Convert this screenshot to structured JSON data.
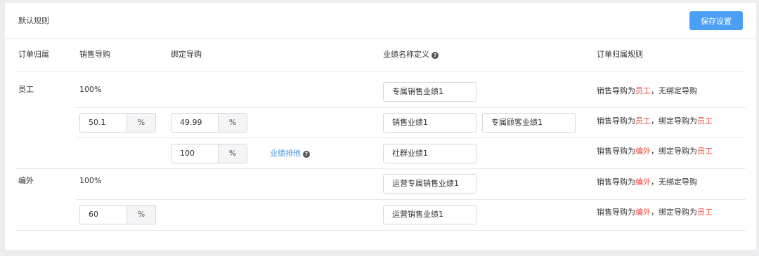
{
  "header": {
    "title": "默认规则",
    "save_label": "保存设置"
  },
  "columns": {
    "ownership": "订单归属",
    "sales_guide": "销售导购",
    "bound_guide": "绑定导购",
    "performance_name": "业绩名称定义",
    "rule": "订单归属规则"
  },
  "help_glyph": "?",
  "unit": "%",
  "groups": {
    "employee": {
      "label": "员工",
      "pct": "100%"
    },
    "external": {
      "label": "编外",
      "pct": "100%"
    }
  },
  "rows": [
    {
      "name": "专属销售业绩1",
      "rule_prefix": "销售导购为",
      "rule_hl1": "员工",
      "rule_mid": "，",
      "rule_tail": "无绑定导购"
    },
    {
      "sales_pct": "50.1",
      "bound_pct": "49.99",
      "name": "销售业绩1",
      "name2": "专属顾客业绩1",
      "rule_prefix": "销售导购为",
      "rule_hl1": "员工",
      "rule_mid": "，绑定导购为",
      "rule_hl2": "员工"
    },
    {
      "bound_pct": "100",
      "link": "业绩排他",
      "name": "社群业绩1",
      "rule_prefix": "销售导购为",
      "rule_hl1": "编外",
      "rule_mid": "，绑定导购为",
      "rule_hl2": "员工"
    },
    {
      "name": "运营专属销售业绩1",
      "rule_prefix": "销售导购为",
      "rule_hl1": "编外",
      "rule_mid": "，",
      "rule_tail": "无绑定导购"
    },
    {
      "sales_pct": "60",
      "name": "运营销售业绩1",
      "rule_prefix": "销售导购为",
      "rule_hl1": "编外",
      "rule_mid": "，绑定导购为",
      "rule_hl2": "员工"
    }
  ],
  "colors": {
    "accent": "#4ba0f6",
    "highlight": "#f24a3e",
    "link": "#3f8ee8"
  }
}
